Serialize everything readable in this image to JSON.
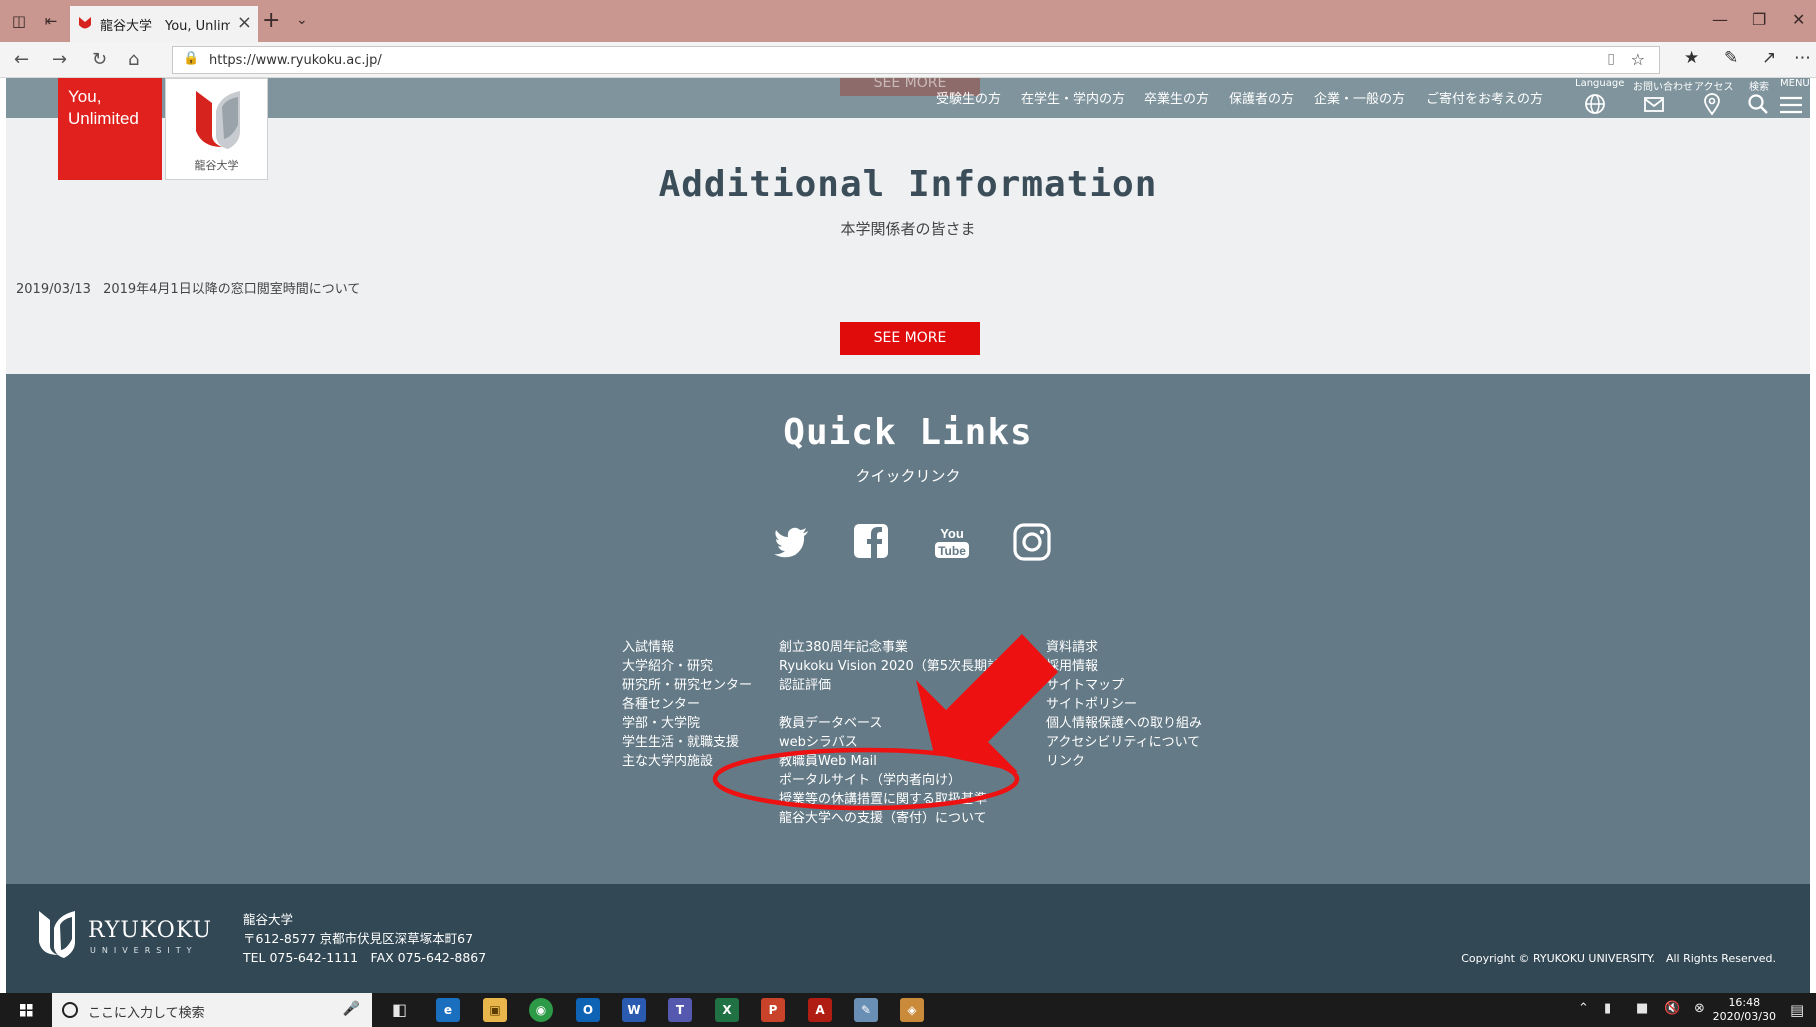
{
  "browser": {
    "tab_title": "龍谷大学　You, Unlimit",
    "url": "https://www.ryukoku.ac.jp/"
  },
  "site_header": {
    "ghost_button": "SEE MORE",
    "nav": [
      "受験生の方",
      "在学生・学内の方",
      "卒業生の方",
      "保護者の方",
      "企業・一般の方",
      "ご寄付をお考えの方"
    ],
    "icons": [
      "Language",
      "お問い合わせ",
      "アクセス",
      "検索",
      "MENU"
    ],
    "brand_tagline": "You,\nUnlimited",
    "brand_name": "龍谷大学"
  },
  "additional": {
    "title": "Additional Information",
    "subtitle": "本学関係者の皆さま",
    "news_date": "2019/03/13",
    "news_text": "2019年4月1日以降の窓口閲室時間について",
    "see_more": "SEE MORE"
  },
  "quick_links": {
    "title": "Quick Links",
    "subtitle": "クイックリンク",
    "col1": [
      "入試情報",
      "大学紹介・研究",
      "研究所・研究センター",
      "各種センター",
      "学部・大学院",
      "学生生活・就職支援",
      "主な大学内施設"
    ],
    "col2a": [
      "創立380周年記念事業",
      "Ryukoku Vision 2020（第5次長期計画）",
      "認証評価"
    ],
    "col2b": [
      "教員データベース",
      "webシラバス",
      "教職員Web Mail",
      "ポータルサイト（学内者向け）",
      "授業等の休講措置に関する取扱基準",
      "龍谷大学への支援（寄付）について"
    ],
    "col3": [
      "資料請求",
      "採用情報",
      "サイトマップ",
      "サイトポリシー",
      "個人情報保護への取り組み",
      "アクセシビリティについて",
      "リンク"
    ]
  },
  "footer": {
    "logo_name": "RYUKOKU",
    "logo_sub": "UNIVERSITY",
    "org": "龍谷大学",
    "address": "〒612-8577 京都市伏見区深草塚本町67",
    "tel": "TEL 075-642-1111　FAX 075-642-8867",
    "copyright": "Copyright © RYUKOKU UNIVERSITY.　All Rights Reserved."
  },
  "taskbar": {
    "search_placeholder": "ここに入力して検索",
    "time": "16:48",
    "date": "2020/03/30"
  },
  "colors": {
    "header_bg": "#7f949c",
    "brand_red": "#e0211d",
    "quick_bg": "#647a86",
    "footer_bg": "#324854",
    "annotation_red": "#ee1111"
  }
}
